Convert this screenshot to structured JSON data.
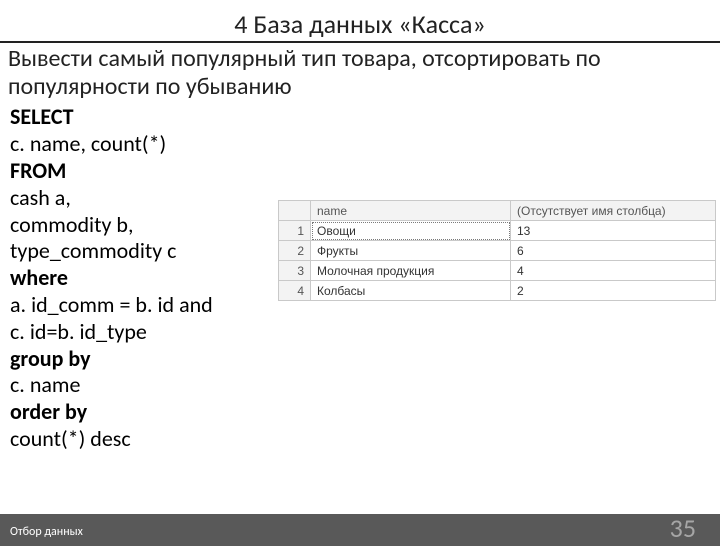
{
  "header": {
    "title": "4  База данных «Касса»",
    "task": "Вывести самый популярный тип товара, отсортировать по популярности по убыванию"
  },
  "sql": {
    "lines": [
      {
        "text": "SELECT",
        "bold": true
      },
      {
        "text": "c. name, count(*)",
        "bold": false
      },
      {
        "text": "FROM",
        "bold": true
      },
      {
        "text": "cash a,",
        "bold": false
      },
      {
        "text": "commodity b,",
        "bold": false
      },
      {
        "text": "type_commodity c",
        "bold": false
      },
      {
        "text": "where",
        "bold": true
      },
      {
        "text": "a. id_comm = b. id and",
        "bold": false
      },
      {
        "text": "c. id=b. id_type",
        "bold": false
      },
      {
        "text": "group by",
        "bold": true
      },
      {
        "text": "c. name",
        "bold": false
      },
      {
        "text": "order by",
        "bold": true
      },
      {
        "text": "count(*) desc",
        "bold": false
      }
    ]
  },
  "result": {
    "headers": {
      "rownum": "",
      "col1": "name",
      "col2": "(Отсутствует имя столбца)"
    },
    "rows": [
      {
        "n": "1",
        "name": "Овощи",
        "count": "13"
      },
      {
        "n": "2",
        "name": "Фрукты",
        "count": "6"
      },
      {
        "n": "3",
        "name": "Молочная продукция",
        "count": "4"
      },
      {
        "n": "4",
        "name": "Колбасы",
        "count": "2"
      }
    ]
  },
  "footer": {
    "left": "Отбор данных",
    "page": "35"
  }
}
